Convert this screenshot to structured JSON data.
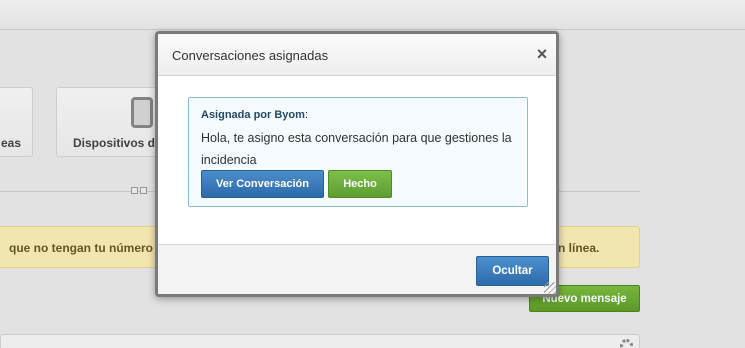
{
  "background": {
    "tiles": [
      {
        "label": "eas"
      },
      {
        "label": "Dispositivos d"
      }
    ],
    "alert": {
      "text_left": "que no tengan tu número a",
      "text_right": "n línea."
    },
    "new_message_button": "Nuevo mensaje"
  },
  "dialog": {
    "title": "Conversaciones asignadas",
    "close_symbol": "×",
    "note": {
      "author_label": "Asignada por Byom",
      "author_suffix": ":",
      "message": "Hola, te asigno esta conversación para que gestiones la incidencia"
    },
    "view_button": "Ver Conversación",
    "done_button": "Hecho",
    "hide_button": "Ocultar"
  }
}
